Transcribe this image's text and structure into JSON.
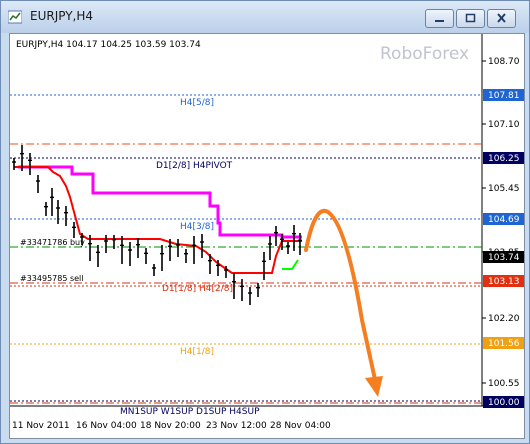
{
  "window": {
    "title": "EURJPY,H4"
  },
  "chart": {
    "info": "EURJPY,H4  104.17 104.25 103.59 103.74",
    "watermark": "RoboForex",
    "colors": {
      "pivot_blue": "#1e64d2",
      "pivot_navy": "#000060",
      "pivot_red": "#e03010",
      "pivot_orange": "#f0a010",
      "pivot_green": "#009000",
      "pivot_redorange": "#e85020",
      "price_bar": "#000000",
      "magenta_line": "#ff00ff",
      "red_line": "#ff0000",
      "green_line": "#00ff00",
      "arrow": "#f57f20"
    },
    "y_ticks": [
      "108.70",
      "107.10",
      "105.45",
      "103.85",
      "102.20",
      "100.55"
    ],
    "x_ticks": [
      "11 Nov 2011",
      "16 Nov 04:00",
      "18 Nov 20:00",
      "23 Nov 12:00",
      "28 Nov 04:00"
    ],
    "levels": [
      {
        "label": "H4[5/8]",
        "price_tag": "107.81",
        "color": "#1e64d2"
      },
      {
        "label": "",
        "price_tag": "",
        "color": "#e85020"
      },
      {
        "label": "D1[2/8] H4PIVOT",
        "price_tag": "106.25",
        "color": "#000060"
      },
      {
        "label": "H4[3/8]",
        "price_tag": "104.69",
        "color": "#1e64d2"
      },
      {
        "label": "#33471786 buy",
        "price_tag": "103.74",
        "color": "#009000"
      },
      {
        "label": "#33495785 sell",
        "price_tag": "103.13",
        "color": "#e03010"
      },
      {
        "label": "D1[1/8] H4[2/8]",
        "price_tag": "",
        "color": "#e03010"
      },
      {
        "label": "H4[1/8]",
        "price_tag": "101.56",
        "color": "#f0a010"
      },
      {
        "label": "MN1SUP W1SUP D1SUP H4SUP",
        "price_tag": "100.00",
        "color": "#000060"
      }
    ]
  }
}
